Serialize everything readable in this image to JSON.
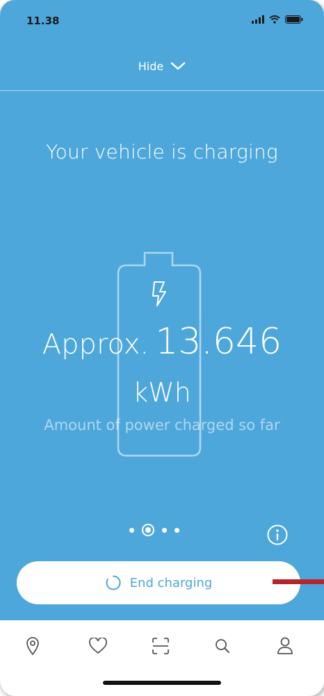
{
  "status_bar": {
    "time": "11.38"
  },
  "header": {
    "hide_label": "Hide"
  },
  "main": {
    "title": "Your vehicle is charging",
    "approx_label": "Approx.",
    "energy_value": "13.646",
    "energy_unit": "kWh",
    "subtitle": "Amount of power charged so far"
  },
  "pager": {
    "page_count": 4,
    "active_index": 1
  },
  "actions": {
    "end_charging_label": "End charging"
  },
  "nav": {
    "items": [
      {
        "icon": "location-pin-icon"
      },
      {
        "icon": "heart-icon"
      },
      {
        "icon": "scan-icon"
      },
      {
        "icon": "search-icon"
      },
      {
        "icon": "profile-icon"
      }
    ]
  },
  "colors": {
    "accent": "#4ea7db",
    "marker": "#b4262c"
  }
}
